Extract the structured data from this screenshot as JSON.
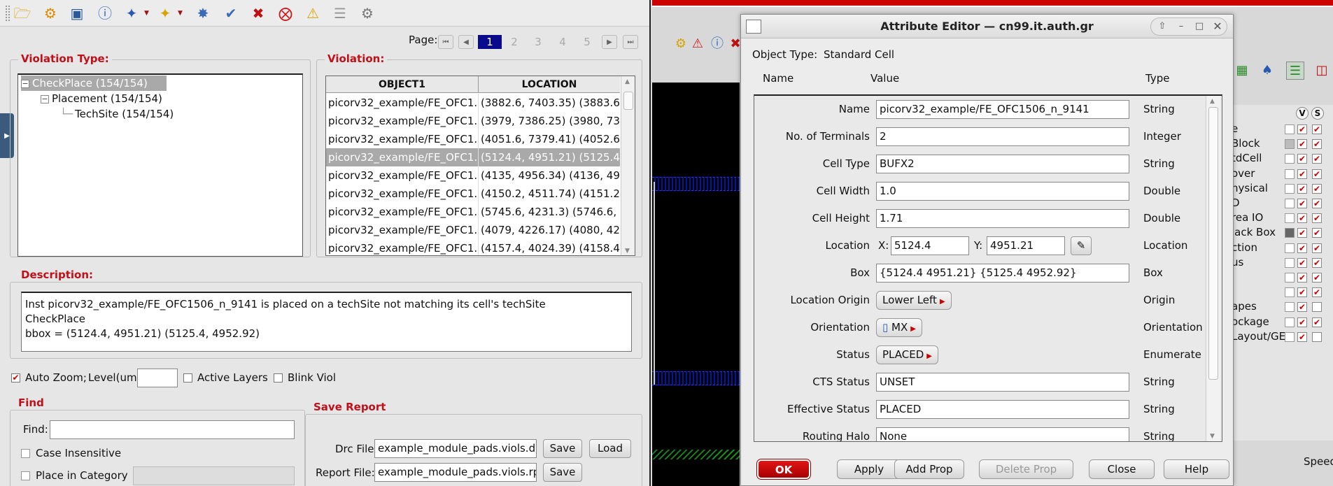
{
  "violation_browser": {
    "toolbar_icons": [
      "open-icon",
      "tools-icon",
      "zoom-icon",
      "info-icon",
      "select-icon",
      "mark-icon",
      "fix-icon",
      "check-icon",
      "delete-icon",
      "stop-icon",
      "warning-icon",
      "filter-icon",
      "settings-icon"
    ],
    "pager": {
      "label": "Page:",
      "pages": [
        "1",
        "2",
        "3",
        "4",
        "5"
      ],
      "current": "1"
    },
    "violation_type": {
      "title": "Violation Type:",
      "tree": [
        {
          "label": "CheckPlace (154/154)",
          "toggle": "−"
        },
        {
          "label": "Placement (154/154)",
          "toggle": "−"
        },
        {
          "label": "TechSite (154/154)",
          "toggle": ""
        }
      ]
    },
    "violation": {
      "title": "Violation:",
      "columns": [
        "OBJECT1",
        "LOCATION"
      ],
      "rows": [
        [
          "picorv32_example/FE_OFC1...",
          "(3882.6, 7403.35) (3883.6, ..."
        ],
        [
          "picorv32_example/FE_OFC1...",
          "(3979, 7386.25) (3980, 73..."
        ],
        [
          "picorv32_example/FE_OFC1...",
          "(4051.6, 7379.41) (4052.6, ..."
        ],
        [
          "picorv32_example/FE_OFC1...",
          "(5124.4, 4951.21) (5125.4, ..."
        ],
        [
          "picorv32_example/FE_OFC1...",
          "(4135, 4956.34) (4136, 49..."
        ],
        [
          "picorv32_example/FE_OFC1...",
          "(4150.2, 4511.74) (4151.2, ..."
        ],
        [
          "picorv32_example/FE_OFC1...",
          "(5745.6, 4231.3) (5746.6, 4..."
        ],
        [
          "picorv32_example/FE_OFC1...",
          "(4079, 4226.17) (4080, 42..."
        ],
        [
          "picorv32_example/FE_OFC1...",
          "(4157.4, 4024.39) (4158.4, ..."
        ]
      ],
      "selected_row": 3
    },
    "description": {
      "title": "Description:",
      "lines": [
        "Inst picorv32_example/FE_OFC1506_n_9141 is placed on a techSite not matching its cell's techSite",
        "CheckPlace",
        "bbox = (5124.4, 4951.21) (5125.4, 4952.92)"
      ]
    },
    "options": {
      "auto_zoom": "Auto Zoom;",
      "level_label": "Level(um)",
      "level_value": "",
      "active_layers": "Active Layers",
      "blink_viol": "Blink Viol"
    },
    "find": {
      "title": "Find",
      "find_label": "Find:",
      "find_value": "",
      "case_insensitive": "Case Insensitive",
      "place_in_category": "Place in Category"
    },
    "save_report": {
      "title": "Save Report",
      "drc_label": "Drc File:",
      "drc_value": "example_module_pads.viols.drc",
      "report_label": "Report File:",
      "report_value": "example_module_pads.viols.rpt",
      "save": "Save",
      "load": "Load"
    }
  },
  "background_editor": {
    "layer_headers": [
      "V",
      "S"
    ],
    "layers": [
      "e",
      "Block",
      "tdCell",
      "over",
      "hysical",
      "D",
      "rea IO",
      "lack Box",
      "ction",
      "us",
      "",
      "",
      "apes",
      "ockage",
      "Layout/GE"
    ],
    "speed_label": "Speed"
  },
  "attribute_editor": {
    "title": "Attribute Editor — cn99.it.auth.gr",
    "object_type_label": "Object Type:",
    "object_type_value": "Standard Cell",
    "headers": {
      "name": "Name",
      "value": "Value",
      "type": "Type"
    },
    "rows": [
      {
        "label": "Name",
        "kind": "text",
        "value": "picorv32_example/FE_OFC1506_n_9141",
        "type": "String"
      },
      {
        "label": "No. of Terminals",
        "kind": "text",
        "value": "2",
        "type": "Integer"
      },
      {
        "label": "Cell Type",
        "kind": "text",
        "value": "BUFX2",
        "type": "String"
      },
      {
        "label": "Cell Width",
        "kind": "text",
        "value": "1.0",
        "type": "Double"
      },
      {
        "label": "Cell Height",
        "kind": "text",
        "value": "1.71",
        "type": "Double"
      },
      {
        "label": "Location",
        "kind": "location",
        "x_label": "X:",
        "x_value": "5124.4",
        "y_label": "Y:",
        "y_value": "4951.21",
        "type": "Location"
      },
      {
        "label": "Box",
        "kind": "text",
        "value": "{5124.4 4951.21} {5125.4 4952.92}",
        "type": "Box"
      },
      {
        "label": "Location Origin",
        "kind": "menu",
        "value": "Lower Left",
        "type": "Origin"
      },
      {
        "label": "Orientation",
        "kind": "menu",
        "value": "MX",
        "type": "Orientation"
      },
      {
        "label": "Status",
        "kind": "menu",
        "value": "PLACED",
        "type": "Enumerate"
      },
      {
        "label": "CTS Status",
        "kind": "text",
        "value": "UNSET",
        "type": "String"
      },
      {
        "label": "Effective Status",
        "kind": "text",
        "value": "PLACED",
        "type": "String"
      },
      {
        "label": "Routing Halo",
        "kind": "text",
        "value": "None",
        "type": "String"
      }
    ],
    "buttons": {
      "ok": "OK",
      "apply": "Apply",
      "add_prop": "Add Prop",
      "delete_prop": "Delete Prop",
      "close": "Close",
      "help": "Help"
    }
  }
}
